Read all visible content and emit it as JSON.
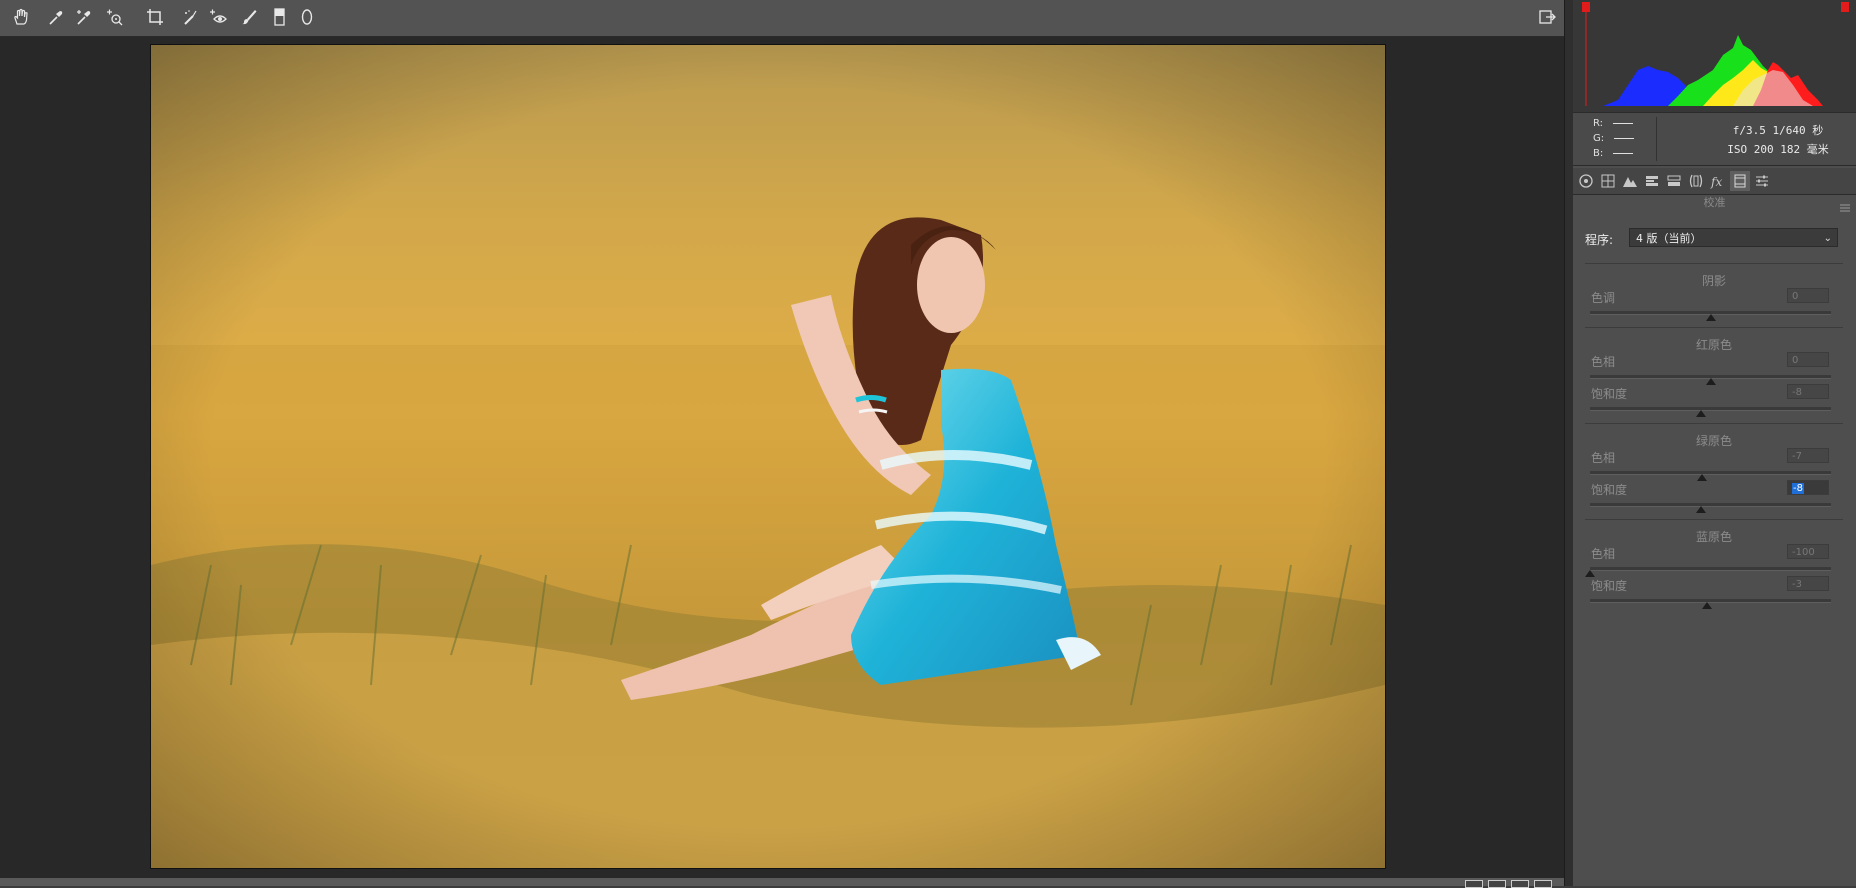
{
  "toolbar": {
    "tools": [
      "hand-icon",
      "white-balance-icon",
      "color-sampler-icon",
      "targeted-adjust-icon",
      "crop-icon",
      "spot-removal-icon",
      "red-eye-icon",
      "adjustment-brush-icon",
      "graduated-filter-icon",
      "radial-filter-icon"
    ],
    "right_tool": "open-preferences-icon"
  },
  "histogram": {
    "clipping_shadows": "shadow-clip-warning-icon",
    "clipping_highlights": "highlight-clip-warning-icon"
  },
  "info": {
    "r_label": "R:",
    "g_label": "G:",
    "b_label": "B:",
    "exif_line1": "f/3.5  1/640 秒",
    "exif_line2": "ISO 200  182 毫米"
  },
  "tabs": [
    "basic-icon",
    "tone-curve-icon",
    "detail-icon",
    "hsl-icon",
    "split-toning-icon",
    "lens-corrections-icon",
    "effects-icon",
    "camera-calibration-icon",
    "presets-icon"
  ],
  "active_tab": 7,
  "calibration": {
    "title": "校准",
    "process_label": "程序:",
    "process_value": "4 版（当前）",
    "shadows": {
      "title": "阴影",
      "tint_label": "色调",
      "tint_value": "0",
      "tint": 0
    },
    "red_primary": {
      "title": "红原色",
      "hue_label": "色相",
      "hue_value": "0",
      "hue": 0,
      "sat_label": "饱和度",
      "sat_value": "-8",
      "sat": -8
    },
    "green_primary": {
      "title": "绿原色",
      "hue_label": "色相",
      "hue_value": "-7",
      "hue": -7,
      "sat_label": "饱和度",
      "sat_value": "-8",
      "sat": -8
    },
    "blue_primary": {
      "title": "蓝原色",
      "hue_label": "色相",
      "hue_value": "-100",
      "hue": -100,
      "sat_label": "饱和度",
      "sat_value": "-3",
      "sat": -3
    }
  },
  "colors": {
    "panel": "#4e4e4e",
    "canvas": "#282828",
    "selection": "#1f6fd6"
  }
}
